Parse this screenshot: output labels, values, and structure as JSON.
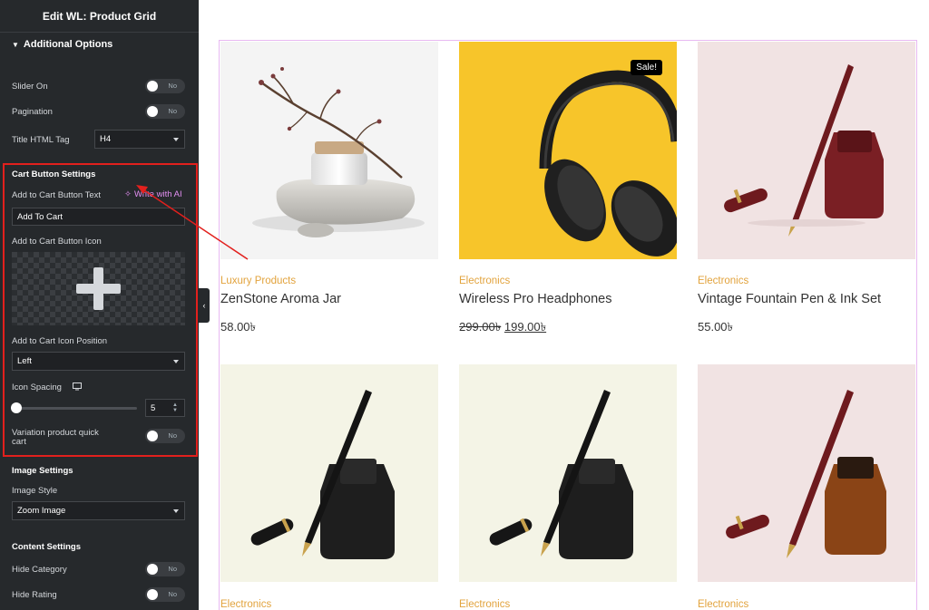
{
  "panel": {
    "title": "Edit WL: Product Grid",
    "section": "Additional Options",
    "slider_on": {
      "label": "Slider On",
      "value": "No"
    },
    "pagination": {
      "label": "Pagination",
      "value": "No"
    },
    "title_tag": {
      "label": "Title HTML Tag",
      "value": "H4"
    },
    "cart": {
      "heading": "Cart Button Settings",
      "text_label": "Add to Cart Button Text",
      "ai_label": "Write with AI",
      "text_value": "Add To Cart",
      "icon_label": "Add to Cart Button Icon",
      "position_label": "Add to Cart Icon Position",
      "position_value": "Left",
      "spacing_label": "Icon Spacing",
      "spacing_value": "5",
      "variation_label_1": "Variation product quick",
      "variation_label_2": "cart",
      "variation_value": "No"
    },
    "image": {
      "heading": "Image Settings",
      "style_label": "Image Style",
      "style_value": "Zoom Image"
    },
    "content": {
      "heading": "Content Settings",
      "hide_category": {
        "label": "Hide Category",
        "value": "No"
      },
      "hide_rating": {
        "label": "Hide Rating",
        "value": "No"
      }
    }
  },
  "products": [
    {
      "category": "Luxury Products",
      "title": "ZenStone Aroma Jar",
      "price": "58.00৳"
    },
    {
      "category": "Electronics",
      "title": "Wireless Pro Headphones",
      "old_price": "299.00৳",
      "new_price": "199.00৳",
      "badge": "Sale!"
    },
    {
      "category": "Electronics",
      "title": "Vintage Fountain Pen & Ink Set",
      "price": "55.00৳"
    },
    {
      "category": "Electronics"
    },
    {
      "category": "Electronics"
    },
    {
      "category": "Electronics"
    }
  ],
  "colors": {
    "sidebar_bg": "#26292c",
    "accent_category": "#e2a33d",
    "ai_link": "#e38ff2",
    "highlight": "#e2201d",
    "headphone_bg": "#f7c52a",
    "pen_pink_bg": "#f1e3e3",
    "pen_cream_bg": "#f4f4e6"
  }
}
